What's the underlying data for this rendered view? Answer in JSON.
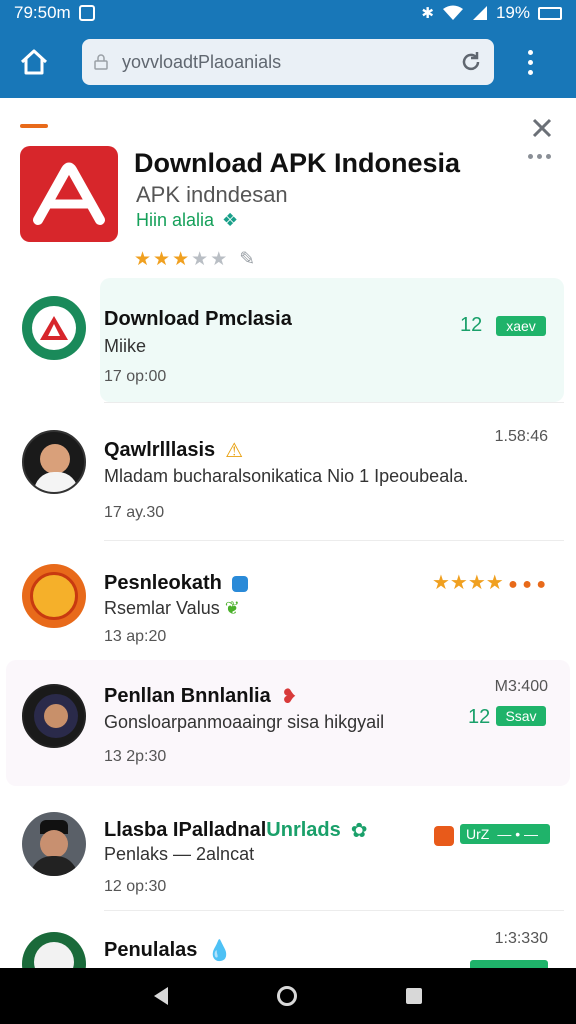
{
  "status_bar": {
    "time": "79:50m",
    "battery": "19%"
  },
  "browser": {
    "url": "yovvloadtPlaoanials"
  },
  "app": {
    "title": "Download APK Indonesia",
    "subtitle": "APK indndesan",
    "developer": "Hiin alalia",
    "rating": 3
  },
  "list": [
    {
      "title": "Download Pmclasia",
      "subtitle": "Miike",
      "time": "17 op:00",
      "right_time": "",
      "number": "12",
      "badge": "xaev",
      "avatar_color": "#1a8a5a"
    },
    {
      "title": "Qawlrlllasis",
      "subtitle": "Mladam bucharalsonikatica Nio 1 Ipeoubeala.",
      "time": "17 ay.30",
      "right_time": "1.58:46",
      "number": "",
      "badge": "",
      "avatar_color": "#1a1a1a"
    },
    {
      "title": "Pesnleokath",
      "subtitle": "Rsemlar Valus",
      "time": "13 ap:20",
      "right_time": "",
      "number": "",
      "badge": "",
      "avatar_color": "#e86a1a"
    },
    {
      "title": "Penllan Bnnlanlia",
      "subtitle": "Gonsloarpanmoaaingr sisa hikgyail",
      "time": "13 2p:30",
      "right_time": "M3:400",
      "number": "12",
      "badge": "Ssav",
      "avatar_color": "#1a1a1a"
    },
    {
      "title": "Llasba IPalladnal",
      "title_suffix": "Unrlads",
      "subtitle": "Penlaks — 2alncat",
      "time": "12 op:30",
      "right_time": "",
      "number": "",
      "badge": "UrZ",
      "avatar_color": "#555555"
    },
    {
      "title": "Penulalas",
      "subtitle": "",
      "time": "",
      "right_time": "1:3:330",
      "number": "",
      "badge": "",
      "avatar_color": "#1a6a3a"
    }
  ],
  "colors": {
    "brand_blue": "#1877b8",
    "accent_green": "#1fb36a",
    "app_red": "#d7262b"
  },
  "icons": [
    "home-icon",
    "lock-icon",
    "reload-icon",
    "overflow-menu-icon",
    "close-icon",
    "back-icon",
    "home-nav-icon",
    "recents-icon"
  ]
}
